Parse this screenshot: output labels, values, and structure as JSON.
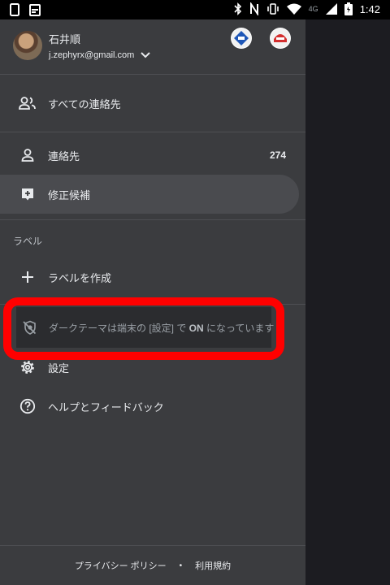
{
  "status_bar": {
    "network": "4G",
    "time": "1:42",
    "icons": [
      "phone-icon",
      "calendar-icon",
      "bluetooth-icon",
      "nfc-icon",
      "vibrate-icon",
      "wifi-icon",
      "signal-icon",
      "battery-icon"
    ]
  },
  "account": {
    "name": "石井順",
    "email": "j.zephyrx@gmail.com"
  },
  "nav": {
    "all_contacts": "すべての連絡先",
    "contacts": "連絡先",
    "contacts_count": "274",
    "suggestions": "修正候補"
  },
  "labels": {
    "header": "ラベル",
    "create": "ラベルを作成"
  },
  "dark_theme_note": {
    "prefix": "ダークテーマは端末の [設定] で ",
    "on": "ON",
    "suffix": " になっています"
  },
  "settings": "設定",
  "help": "ヘルプとフィードバック",
  "footer": {
    "privacy": "プライバシー ポリシー",
    "separator": "•",
    "terms": "利用規約"
  },
  "colors": {
    "drawer_bg": "#3b3c3f",
    "selected_bg": "#4a4b4f",
    "highlight": "#ff0000"
  }
}
